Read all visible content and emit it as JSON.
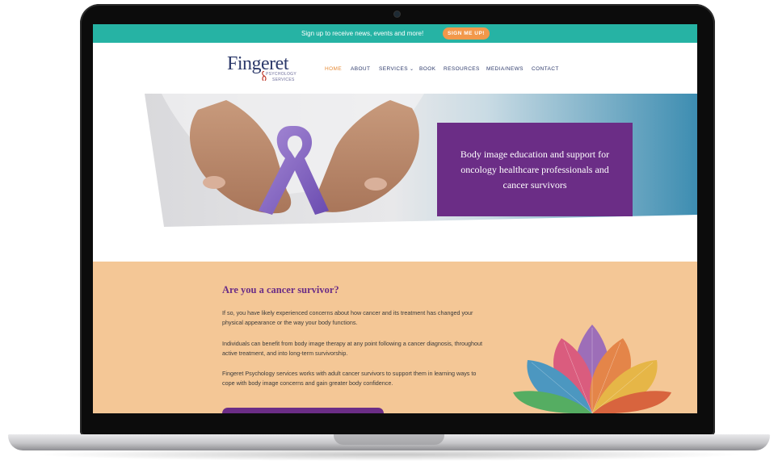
{
  "topbar": {
    "message": "Sign up to receive news, events and more!",
    "button_label": "SIGN ME UP!"
  },
  "logo": {
    "name": "Fingeret",
    "line1": "PSYCHOLOGY",
    "line2": "SERVICES"
  },
  "nav": {
    "items": [
      {
        "label": "HOME",
        "active": true
      },
      {
        "label": "ABOUT"
      },
      {
        "label": "SERVICES"
      },
      {
        "label": "BOOK"
      },
      {
        "label": "RESOURCES"
      },
      {
        "label": "MEDIA/NEWS"
      },
      {
        "label": "CONTACT"
      }
    ],
    "services_chevron_icon": "chevron-down-icon"
  },
  "hero": {
    "tagline": "Body image education and support for oncology healthcare professionals and cancer survivors"
  },
  "survivor": {
    "title": "Are you a cancer survivor?",
    "paragraphs": [
      "If so, you have likely experienced concerns about how cancer and its treatment has changed your physical appearance or the way your body functions.",
      "Individuals can benefit from body image therapy at any point following a cancer diagnosis, throughout active treatment, and into long-term survivorship.",
      "Fingeret Psychology services works with adult cancer survivors to support them in learning ways to cope with body image concerns and gain greater body confidence."
    ]
  },
  "colors": {
    "teal": "#26b3a4",
    "orange": "#f2984a",
    "purple": "#6b2d86",
    "peach": "#f4c796",
    "navy": "#2d3a6b"
  }
}
